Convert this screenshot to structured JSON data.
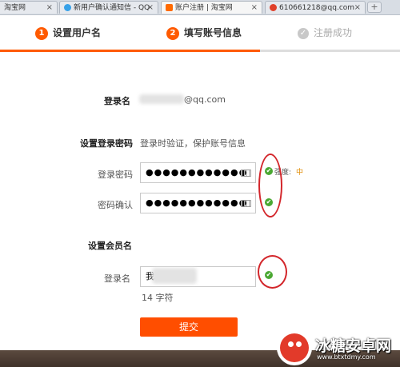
{
  "browser": {
    "tabs": [
      {
        "title": "淘宝网",
        "favicon_color": "#ff6a00"
      },
      {
        "title": "新用户确认通知信 - QQ",
        "favicon_color": "#37a1e8"
      },
      {
        "title": "账户注册 | 淘宝网",
        "favicon_color": "#ff6a00"
      },
      {
        "title": "610661218@qq.com",
        "favicon_color": "#e0402a"
      }
    ],
    "close_glyph": "×",
    "new_tab_glyph": "+"
  },
  "steps": [
    {
      "num": "1",
      "label": "设置用户名"
    },
    {
      "num": "2",
      "label": "填写账号信息"
    },
    {
      "num": "✓",
      "label": "注册成功"
    }
  ],
  "progress_fraction": 0.65,
  "form": {
    "login_name_label": "登录名",
    "login_name_value": "@qq.com",
    "password_section_title": "设置登录密码",
    "password_section_hint": "登录时验证，保护账号信息",
    "password_label": "登录密码",
    "password_value": "●●●●●●●●●●●●",
    "confirm_label": "密码确认",
    "confirm_value": "●●●●●●●●●●●●",
    "strength_label": "强度:",
    "strength_value": "中",
    "member_section_title": "设置会员名",
    "member_label": "登录名",
    "member_value": "我",
    "member_char_count": "14 字符",
    "submit_label": "提交",
    "check_glyph": "✔"
  },
  "watermark": {
    "title": "冰糖安卓网",
    "url": "www.btxtdmy.com"
  },
  "colors": {
    "accent": "#ff5a00",
    "submit": "#ff4e00",
    "valid": "#4aa832",
    "annotation": "#d3262b"
  }
}
